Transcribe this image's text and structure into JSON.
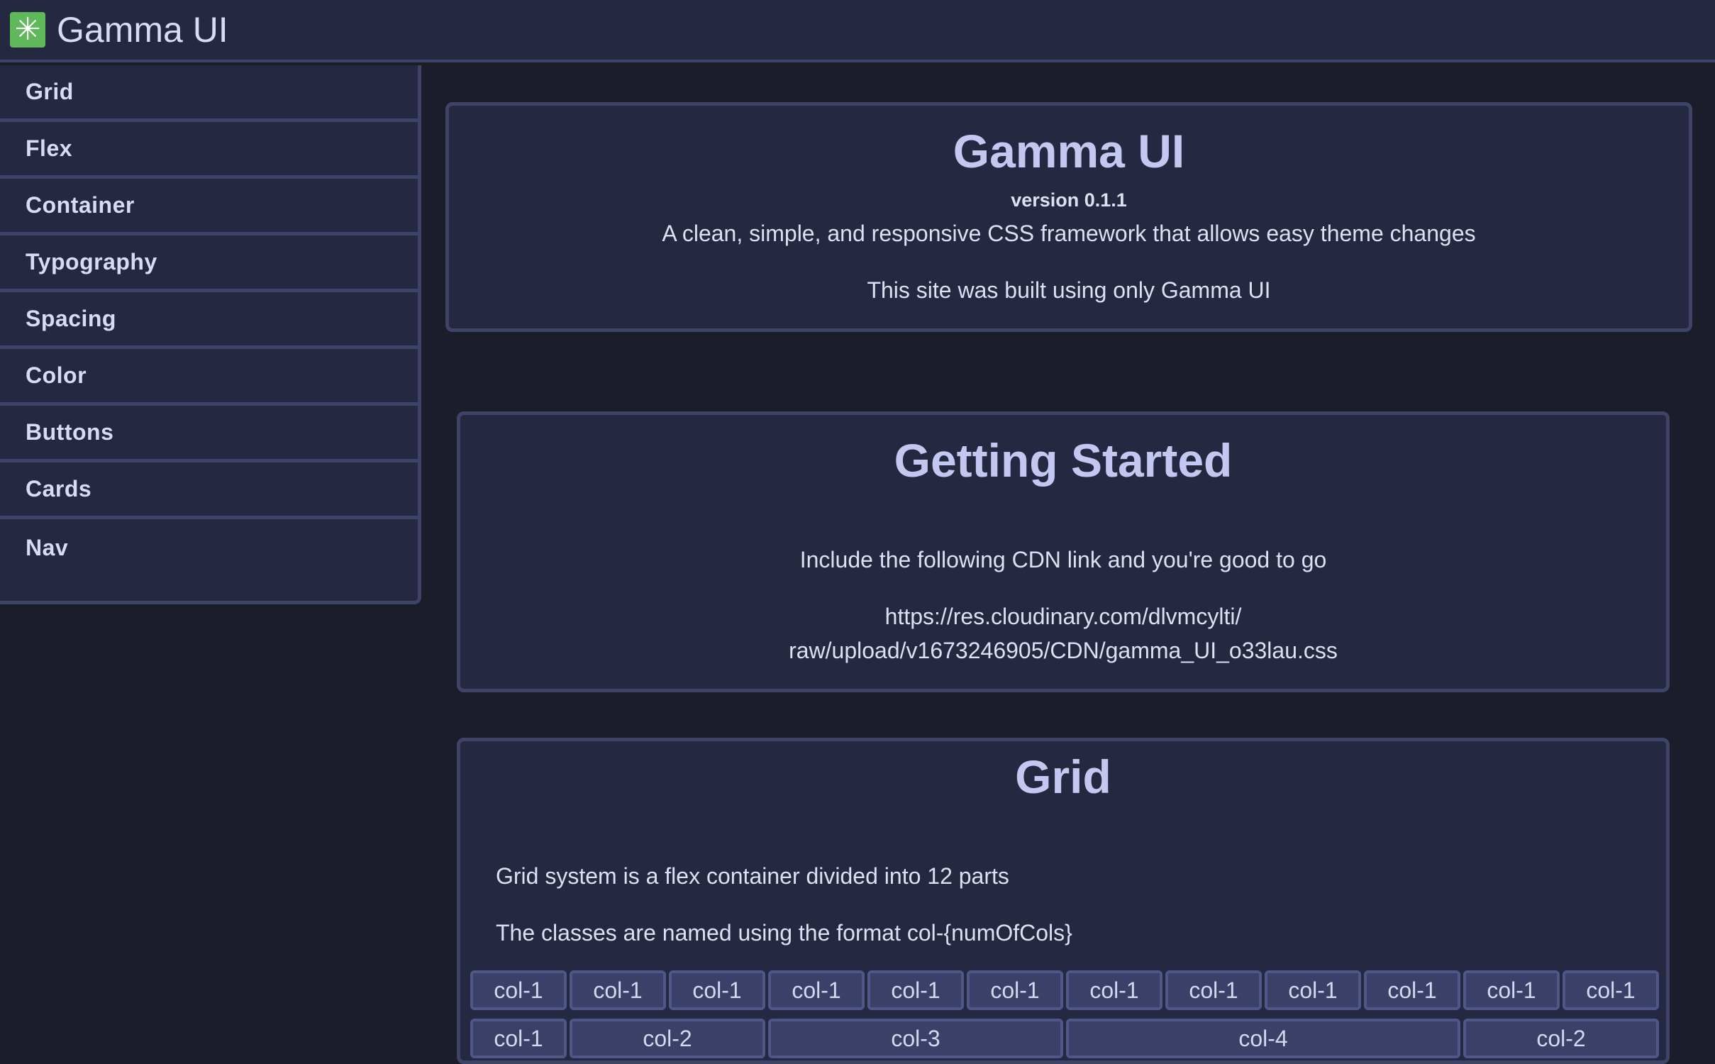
{
  "app": {
    "brand_icon": "asterisk-icon",
    "brand_icon_glyph": "✳",
    "brand_name": "Gamma UI",
    "colors": {
      "background": "#1c1d2b",
      "panel": "#242840",
      "border": "#3d4468",
      "logo": "#5fb85a",
      "heading": "#c4c8f0"
    }
  },
  "sidebar": {
    "items": [
      {
        "label": "Grid"
      },
      {
        "label": "Flex"
      },
      {
        "label": "Container"
      },
      {
        "label": "Typography"
      },
      {
        "label": "Spacing"
      },
      {
        "label": "Color"
      },
      {
        "label": "Buttons"
      },
      {
        "label": "Cards"
      },
      {
        "label": "Nav"
      }
    ]
  },
  "hero": {
    "title": "Gamma UI",
    "version": "version 0.1.1",
    "description": "A clean, simple, and responsive CSS framework that allows easy theme changes",
    "note": "This site was built using only Gamma UI"
  },
  "getting_started": {
    "title": "Getting Started",
    "intro": "Include the following CDN link and you're good to go",
    "cdn_line1": "https://res.cloudinary.com/dlvmcylti/",
    "cdn_line2": "raw/upload/v1673246905/CDN/gamma_UI_o33lau.css"
  },
  "grid_section": {
    "title": "Grid",
    "desc1": "Grid system is a flex container divided into 12 parts",
    "desc2": "The classes are named using the format col-{numOfCols}",
    "row1": [
      {
        "label": "col-1",
        "span": 1
      },
      {
        "label": "col-1",
        "span": 1
      },
      {
        "label": "col-1",
        "span": 1
      },
      {
        "label": "col-1",
        "span": 1
      },
      {
        "label": "col-1",
        "span": 1
      },
      {
        "label": "col-1",
        "span": 1
      },
      {
        "label": "col-1",
        "span": 1
      },
      {
        "label": "col-1",
        "span": 1
      },
      {
        "label": "col-1",
        "span": 1
      },
      {
        "label": "col-1",
        "span": 1
      },
      {
        "label": "col-1",
        "span": 1
      },
      {
        "label": "col-1",
        "span": 1
      }
    ],
    "row2": [
      {
        "label": "col-1",
        "span": 1
      },
      {
        "label": "col-2",
        "span": 2
      },
      {
        "label": "col-3",
        "span": 3
      },
      {
        "label": "col-4",
        "span": 4
      },
      {
        "label": "col-2",
        "span": 2
      }
    ]
  }
}
